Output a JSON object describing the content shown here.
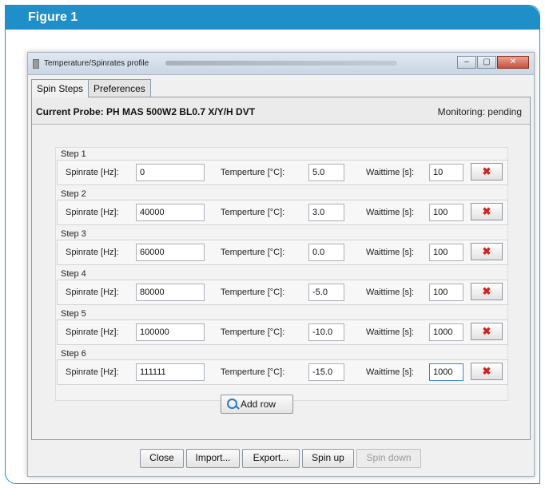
{
  "figure": {
    "title": "Figure 1"
  },
  "window": {
    "title": "Temperature/Spinrates profile",
    "controls": {
      "minimize": "–",
      "maximize": "▢",
      "close": "✕"
    }
  },
  "tabs": [
    {
      "label": "Spin Steps",
      "active": true
    },
    {
      "label": "Preferences",
      "active": false
    }
  ],
  "probe": {
    "label": "Current Probe: PH MAS 500W2 BL0.7 X/Y/H DVT",
    "monitoring": "Monitoring: pending"
  },
  "labels": {
    "spinrate": "Spinrate [Hz]:",
    "temperature": "Temperture [°C]:",
    "waittime": "Waittime [s]:",
    "delete": "✖"
  },
  "steps": [
    {
      "title": "Step 1",
      "spinrate": "0",
      "temperature": "5.0",
      "waittime": "10"
    },
    {
      "title": "Step 2",
      "spinrate": "40000",
      "temperature": "3.0",
      "waittime": "100"
    },
    {
      "title": "Step 3",
      "spinrate": "60000",
      "temperature": "0.0",
      "waittime": "100"
    },
    {
      "title": "Step 4",
      "spinrate": "80000",
      "temperature": "-5.0",
      "waittime": "100"
    },
    {
      "title": "Step 5",
      "spinrate": "100000",
      "temperature": "-10.0",
      "waittime": "1000"
    },
    {
      "title": "Step 6",
      "spinrate": "111111",
      "temperature": "-15.0",
      "waittime": "1000"
    }
  ],
  "add_row": {
    "label": "Add row",
    "icon": "search-icon"
  },
  "footer": {
    "close": "Close",
    "import": "Import...",
    "export": "Export...",
    "spin_up": "Spin up",
    "spin_down": "Spin down"
  },
  "colors": {
    "figure_accent": "#1f8fc9",
    "delete_icon": "#d6211b"
  }
}
